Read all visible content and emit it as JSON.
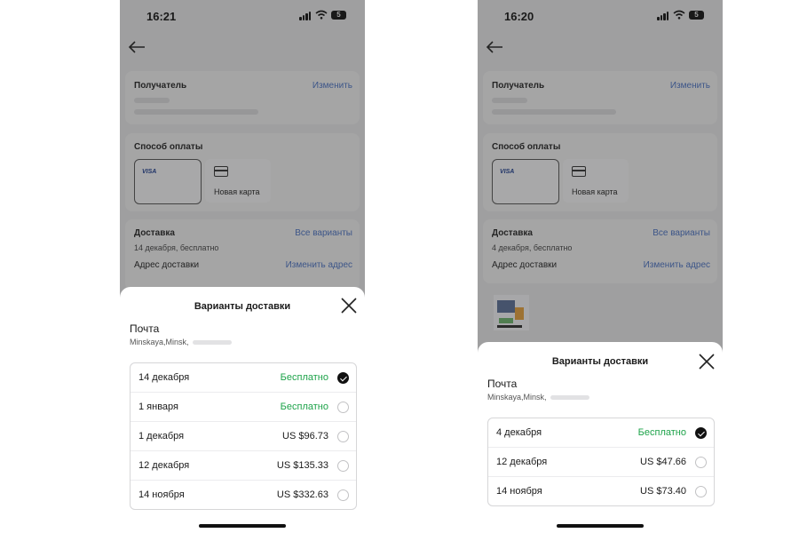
{
  "screens": [
    {
      "status": {
        "time": "16:21",
        "battery": "5"
      },
      "recipient": {
        "title": "Получатель",
        "action": "Изменить"
      },
      "payment": {
        "title": "Способ оплаты",
        "card_brand": "VISA",
        "new_card": "Новая карта"
      },
      "delivery": {
        "title": "Доставка",
        "all_options": "Все варианты",
        "date_note": "14 декабря, бесплатно",
        "address_label": "Адрес доставки",
        "change_address": "Изменить адрес"
      },
      "sheet": {
        "title": "Варианты доставки",
        "method": "Почта",
        "address": "Minskaya,Minsk,",
        "options": [
          {
            "date": "14 декабря",
            "price": "Бесплатно",
            "free": true,
            "selected": true
          },
          {
            "date": "1 января",
            "price": "Бесплатно",
            "free": true,
            "selected": false
          },
          {
            "date": "1 декабря",
            "price": "US $96.73",
            "free": false,
            "selected": false
          },
          {
            "date": "12 декабря",
            "price": "US $135.33",
            "free": false,
            "selected": false
          },
          {
            "date": "14 ноября",
            "price": "US $332.63",
            "free": false,
            "selected": false
          }
        ]
      }
    },
    {
      "status": {
        "time": "16:20",
        "battery": "5"
      },
      "recipient": {
        "title": "Получатель",
        "action": "Изменить"
      },
      "payment": {
        "title": "Способ оплаты",
        "card_brand": "VISA",
        "new_card": "Новая карта"
      },
      "delivery": {
        "title": "Доставка",
        "all_options": "Все варианты",
        "date_note": "4 декабря, бесплатно",
        "address_label": "Адрес доставки",
        "change_address": "Изменить адрес"
      },
      "sheet": {
        "title": "Варианты доставки",
        "method": "Почта",
        "address": "Minskaya,Minsk,",
        "options": [
          {
            "date": "4 декабря",
            "price": "Бесплатно",
            "free": true,
            "selected": true
          },
          {
            "date": "12 декабря",
            "price": "US $47.66",
            "free": false,
            "selected": false
          },
          {
            "date": "14 ноября",
            "price": "US $73.40",
            "free": false,
            "selected": false
          }
        ]
      }
    }
  ],
  "colors": {
    "free_price": "#1ea34a",
    "link": "#4a72c4",
    "overlay": "rgba(40,40,40,0.38)"
  }
}
